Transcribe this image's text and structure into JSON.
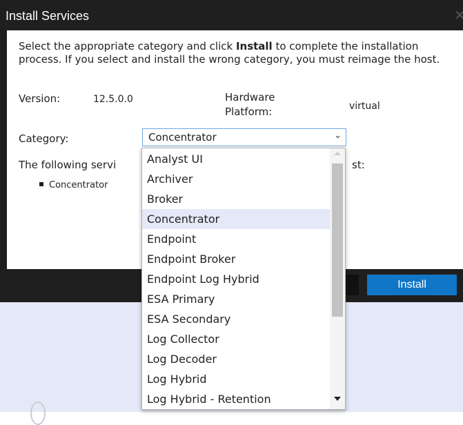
{
  "dialog": {
    "title": "Install Services",
    "close_glyph": "✕",
    "description_pre": "Select the appropriate category and click ",
    "description_bold": "Install",
    "description_post": " to complete the installation process. If you select and install the wrong category, you must reimage the host.",
    "version_label": "Version:",
    "version_value": "12.5.0.0",
    "hardware_label_line1": "Hardware",
    "hardware_label_line2": "Platform:",
    "hardware_value": "virtual",
    "category_label": "Category:",
    "category_selected": "Concentrator",
    "services_text_left": "The following servi",
    "services_text_right": "st:",
    "service_item": "Concentrator",
    "install_label": "Install"
  },
  "dropdown": {
    "options": [
      "Analyst UI",
      "Archiver",
      "Broker",
      "Concentrator",
      "Endpoint",
      "Endpoint Broker",
      "Endpoint Log Hybrid",
      "ESA Primary",
      "ESA Secondary",
      "Log Collector",
      "Log Decoder",
      "Log Hybrid",
      "Log Hybrid - Retention"
    ],
    "selected": "Concentrator"
  },
  "colors": {
    "accent": "#1176c6",
    "dialog_frame": "#1f1f1f",
    "selected_option": "#e5e8f7"
  },
  "icons": {
    "dropdown_chevron": "chevron-down-icon",
    "close": "close-icon",
    "bullet": "bullet-icon"
  }
}
